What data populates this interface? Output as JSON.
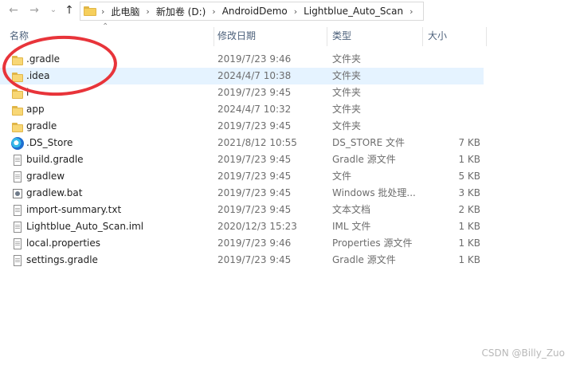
{
  "address_bar": {
    "crumbs": [
      "此电脑",
      "新加卷 (D:)",
      "AndroidDemo",
      "Lightblue_Auto_Scan"
    ]
  },
  "columns": {
    "name": "名称",
    "date": "修改日期",
    "type": "类型",
    "size": "大小"
  },
  "files": [
    {
      "name": ".gradle",
      "date": "2019/7/23 9:46",
      "type": "文件夹",
      "size": "",
      "icon": "folder-icon"
    },
    {
      "name": ".idea",
      "date": "2024/4/7 10:38",
      "type": "文件夹",
      "size": "",
      "icon": "folder-icon"
    },
    {
      "name": "l",
      "date": "2019/7/23 9:45",
      "type": "文件夹",
      "size": "",
      "icon": "folder-icon"
    },
    {
      "name": "app",
      "date": "2024/4/7 10:32",
      "type": "文件夹",
      "size": "",
      "icon": "folder-icon"
    },
    {
      "name": "gradle",
      "date": "2019/7/23 9:45",
      "type": "文件夹",
      "size": "",
      "icon": "folder-icon"
    },
    {
      "name": ".DS_Store",
      "date": "2021/8/12 10:55",
      "type": "DS_STORE 文件",
      "size": "7 KB",
      "icon": "edge-icon"
    },
    {
      "name": "build.gradle",
      "date": "2019/7/23 9:45",
      "type": "Gradle 源文件",
      "size": "1 KB",
      "icon": "file-icon"
    },
    {
      "name": "gradlew",
      "date": "2019/7/23 9:45",
      "type": "文件",
      "size": "5 KB",
      "icon": "file-icon"
    },
    {
      "name": "gradlew.bat",
      "date": "2019/7/23 9:45",
      "type": "Windows 批处理...",
      "size": "3 KB",
      "icon": "bat-icon"
    },
    {
      "name": "import-summary.txt",
      "date": "2019/7/23 9:45",
      "type": "文本文档",
      "size": "2 KB",
      "icon": "file-icon"
    },
    {
      "name": "Lightblue_Auto_Scan.iml",
      "date": "2020/12/3 15:23",
      "type": "IML 文件",
      "size": "1 KB",
      "icon": "file-icon"
    },
    {
      "name": "local.properties",
      "date": "2019/7/23 9:46",
      "type": "Properties 源文件",
      "size": "1 KB",
      "icon": "file-icon"
    },
    {
      "name": "settings.gradle",
      "date": "2019/7/23 9:45",
      "type": "Gradle 源文件",
      "size": "1 KB",
      "icon": "file-icon"
    }
  ],
  "selected_index": 1,
  "watermark": "CSDN @Billy_Zuo",
  "colors": {
    "selection": "#e5f3ff",
    "annotation": "#e8343a",
    "folder": "#f8d775"
  }
}
